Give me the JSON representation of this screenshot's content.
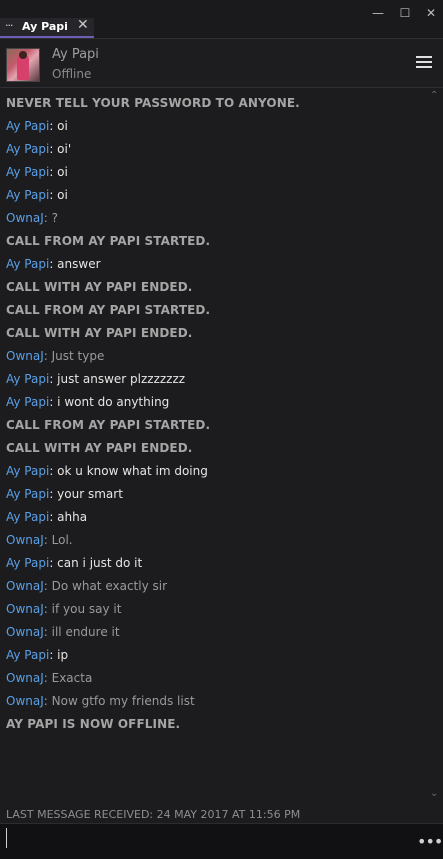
{
  "tab": {
    "label": "Ay Papi",
    "dots": "···",
    "close": "✕"
  },
  "window_controls": {
    "minimize": "—",
    "maximize": "☐",
    "close": "✕"
  },
  "header": {
    "name": "Ay Papi",
    "status": "Offline"
  },
  "chat": {
    "messages": [
      {
        "type": "system",
        "text": "NEVER TELL YOUR PASSWORD TO ANYONE."
      },
      {
        "type": "them",
        "sender": "Ay Papi",
        "text": ": oi"
      },
      {
        "type": "them",
        "sender": "Ay Papi",
        "text": ": oi'"
      },
      {
        "type": "them",
        "sender": "Ay Papi",
        "text": ": oi"
      },
      {
        "type": "them",
        "sender": "Ay Papi",
        "text": ": oi"
      },
      {
        "type": "me",
        "sender": "OwnaJ",
        "text": ": ?"
      },
      {
        "type": "system",
        "text": "CALL FROM AY PAPI STARTED."
      },
      {
        "type": "them",
        "sender": "Ay Papi",
        "text": ": answer"
      },
      {
        "type": "system",
        "text": "CALL WITH AY PAPI ENDED."
      },
      {
        "type": "system",
        "text": "CALL FROM AY PAPI STARTED."
      },
      {
        "type": "system",
        "text": "CALL WITH AY PAPI ENDED."
      },
      {
        "type": "me",
        "sender": "OwnaJ",
        "text": ": Just type"
      },
      {
        "type": "them",
        "sender": "Ay Papi",
        "text": ": just answer plzzzzzzz"
      },
      {
        "type": "them",
        "sender": "Ay Papi",
        "text": ": i wont do anything"
      },
      {
        "type": "system",
        "text": "CALL FROM AY PAPI STARTED."
      },
      {
        "type": "system",
        "text": "CALL WITH AY PAPI ENDED."
      },
      {
        "type": "them",
        "sender": "Ay Papi",
        "text": ": ok u know what im doing"
      },
      {
        "type": "them",
        "sender": "Ay Papi",
        "text": ": your smart"
      },
      {
        "type": "them",
        "sender": "Ay Papi",
        "text": ": ahha"
      },
      {
        "type": "me",
        "sender": "OwnaJ",
        "text": ": Lol."
      },
      {
        "type": "them",
        "sender": "Ay Papi",
        "text": ": can i just do it"
      },
      {
        "type": "me",
        "sender": "OwnaJ",
        "text": ": Do what exactly sir"
      },
      {
        "type": "me",
        "sender": "OwnaJ",
        "text": ": if you say it"
      },
      {
        "type": "me",
        "sender": "OwnaJ",
        "text": ": ill endure it"
      },
      {
        "type": "them",
        "sender": "Ay Papi",
        "text": ": ip"
      },
      {
        "type": "me",
        "sender": "OwnaJ",
        "text": ": Exacta"
      },
      {
        "type": "me",
        "sender": "OwnaJ",
        "text": ": Now gtfo my friends list"
      },
      {
        "type": "system",
        "text": "AY PAPI IS NOW OFFLINE."
      }
    ]
  },
  "footer": {
    "last_received": "LAST MESSAGE RECEIVED: 24 MAY 2017 AT 11:56 PM",
    "input_value": "",
    "more": "•••"
  },
  "colors": {
    "sender": "#5aa0e6",
    "tab_accent": "#6b5fb5",
    "background": "#1c1c1e"
  }
}
